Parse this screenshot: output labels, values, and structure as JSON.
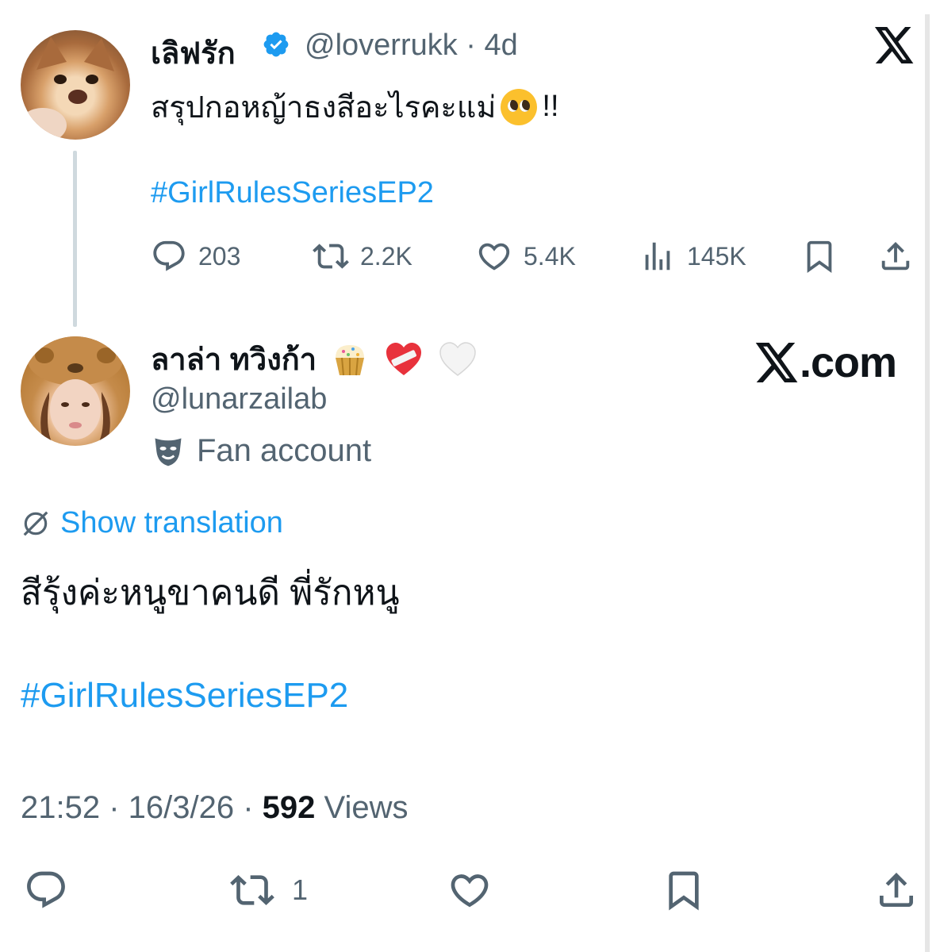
{
  "tweet1": {
    "name": "เลิฟรัก",
    "handle": "@loverrukk",
    "time": "4d",
    "text": "สรุปกอหญ้าธงสีอะไรคะแม่",
    "text_suffix": "!!",
    "hashtag": "#GirlRulesSeriesEP2",
    "stats": {
      "replies": "203",
      "reposts": "2.2K",
      "likes": "5.4K",
      "views": "145K"
    }
  },
  "tweet2": {
    "name": "ลาล่า ทวิงก้า",
    "handle": "@lunarzailab",
    "label": "Fan account",
    "translate": "Show translation",
    "text": "สีรุ้งค่ะหนูขาคนดี พี่รักหนู",
    "hashtag": "#GirlRulesSeriesEP2",
    "time": "21:52",
    "date": "16/3/26",
    "views_count": "592",
    "views_label": "Views",
    "reposts": "1"
  },
  "branding": {
    "watermark": "X.com"
  },
  "colors": {
    "link": "#1d9bf0",
    "secondary": "#536471",
    "text": "#0f1419"
  }
}
